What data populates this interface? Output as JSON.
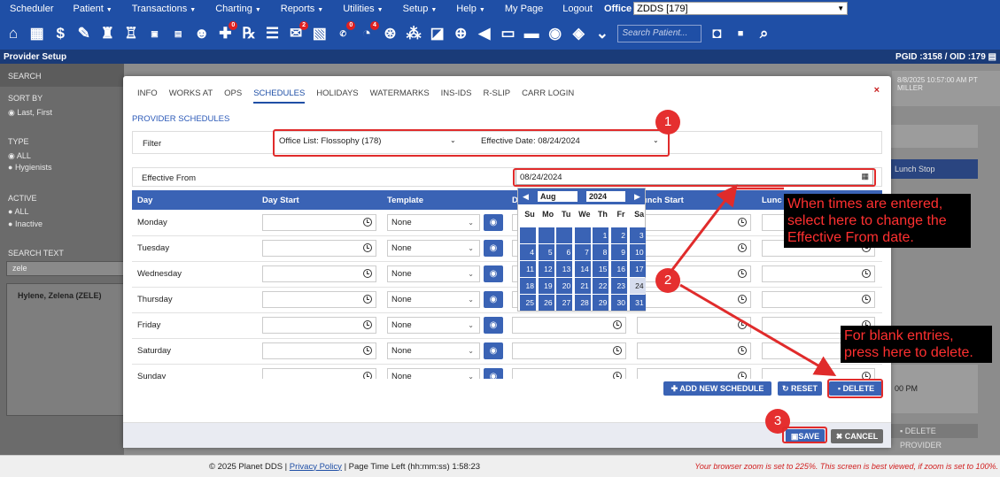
{
  "menu": {
    "items": [
      "Scheduler",
      "Patient",
      "Transactions",
      "Charting",
      "Reports",
      "Utilities",
      "Setup",
      "Help",
      "My Page",
      "Logout"
    ],
    "office_label": "Office",
    "office_value": "ZDDS [179]"
  },
  "toolbar": {
    "search_placeholder": "Search Patient...",
    "badges": {
      "note": "0",
      "rx_note": "2",
      "sms": "0",
      "lab": "4"
    }
  },
  "provider_bar": {
    "title": "Provider Setup",
    "pgid": "PGID :3158  /  OID :179"
  },
  "sidebar": {
    "search": "SEARCH",
    "sort_by": "SORT BY",
    "sort_value": "Last, First",
    "type": "TYPE",
    "type_all": "ALL",
    "type_hygienists": "Hygienists",
    "active": "ACTIVE",
    "active_all": "ALL",
    "active_inactive": "Inactive",
    "search_text": "SEARCH TEXT",
    "search_value": "zele",
    "result": "Hylene, Zelena (ZELE)"
  },
  "background_panel": {
    "timestamp": "8/8/2025 10:57:00 AM PT",
    "user": "MILLER",
    "column_lunch_stop": "Lunch Stop",
    "time_00pm": "00 PM",
    "delete_provider": "DELETE PROVIDER"
  },
  "modal": {
    "tabs": [
      "INFO",
      "WORKS AT",
      "OPS",
      "SCHEDULES",
      "HOLIDAYS",
      "WATERMARKS",
      "INS-IDS",
      "R-SLIP",
      "CARR LOGIN"
    ],
    "active_tab": "SCHEDULES",
    "close": "×",
    "section_title": "PROVIDER SCHEDULES",
    "filter_label": "Filter",
    "office_list": "Office List: Flossophy (178)",
    "effective_date": "Effective Date: 08/24/2024",
    "effective_from_label": "Effective From",
    "effective_from_value": "08/24/2024",
    "columns": [
      "Day",
      "Day Start",
      "Template",
      "D",
      "Lunch Start",
      "Lunc"
    ],
    "days": [
      "Monday",
      "Tuesday",
      "Wednesday",
      "Thursday",
      "Friday",
      "Saturday",
      "Sunday"
    ],
    "template_value": "None",
    "buttons": {
      "add": "ADD NEW SCHEDULE",
      "reset": "RESET",
      "delete": "DELETE",
      "save": "SAVE",
      "cancel": "CANCEL"
    }
  },
  "calendar": {
    "month": "Aug",
    "year": "2024",
    "weekdays": [
      "Su",
      "Mo",
      "Tu",
      "We",
      "Th",
      "Fr",
      "Sa"
    ],
    "selected_day": 24,
    "weeks": [
      [
        null,
        null,
        null,
        null,
        1,
        2,
        3
      ],
      [
        4,
        5,
        6,
        7,
        8,
        9,
        10
      ],
      [
        11,
        12,
        13,
        14,
        15,
        16,
        17
      ],
      [
        18,
        19,
        20,
        21,
        22,
        23,
        24
      ],
      [
        25,
        26,
        27,
        28,
        29,
        30,
        31
      ]
    ]
  },
  "annotations": {
    "step1": "1",
    "step2": "2",
    "step3": "3",
    "note1": "When times are entered, select here to change the Effective From date.",
    "note2": "For blank entries, press here to delete."
  },
  "footer": {
    "copyright": "© 2025 Planet DDS |",
    "privacy": "Privacy Policy",
    "time_left": "| Page Time Left (hh:mm:ss) 1:58:23",
    "zoom_warning": "Your browser zoom is set to 225%. This screen is best viewed, if zoom is set to 100%."
  },
  "colors": {
    "nav": "#1f4fa6",
    "accent": "#3a63b5",
    "annotation": "#e02b2b"
  }
}
